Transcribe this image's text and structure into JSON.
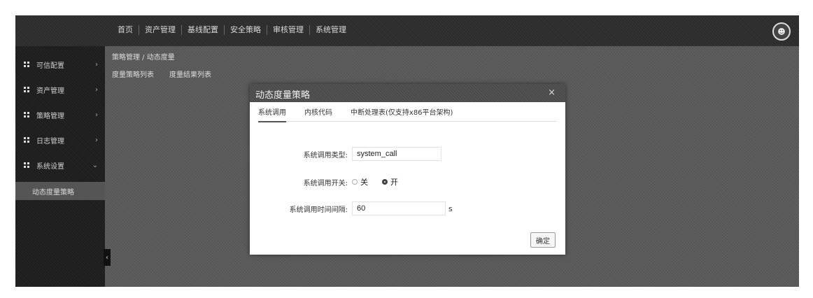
{
  "topnav": {
    "items": [
      "首页",
      "资产管理",
      "基线配置",
      "安全策略",
      "审核管理",
      "系统管理"
    ]
  },
  "sidebar": {
    "items": [
      {
        "label": "可信配置",
        "icon": "grid-icon"
      },
      {
        "label": "资产管理",
        "icon": "grid-icon"
      },
      {
        "label": "策略管理",
        "icon": "grid-icon"
      },
      {
        "label": "日志管理",
        "icon": "grid-icon"
      },
      {
        "label": "系统设置",
        "icon": "grid-icon"
      }
    ],
    "active_sub": "动态度量策略"
  },
  "background": {
    "breadcrumb": "策略管理 / 动态度量",
    "tabs": [
      "度量策略列表",
      "度量结果列表"
    ]
  },
  "modal": {
    "title": "动态度量策略",
    "tabs": [
      "系统调用",
      "内核代码",
      "中断处理表(仅支持x86平台架构)"
    ],
    "active_tab": 0,
    "fields": {
      "syscall_type_label": "系统调用类型:",
      "syscall_type_value": "system_call",
      "switch_label": "系统调用开关:",
      "switch_off": "关",
      "switch_on": "开",
      "switch_selected": "开",
      "interval_label": "系统调用时间间隔:",
      "interval_value": "60",
      "interval_unit": "s"
    },
    "ok_label": "确定"
  }
}
